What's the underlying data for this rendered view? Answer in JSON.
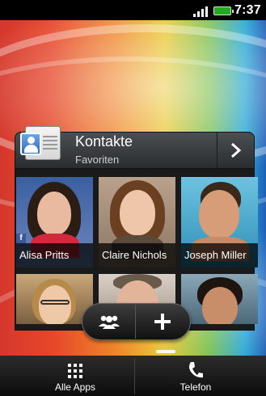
{
  "status_bar": {
    "time": "7:37"
  },
  "widget": {
    "title": "Kontakte",
    "subtitle": "Favoriten",
    "contacts": [
      {
        "name": "Alisa Pritts"
      },
      {
        "name": "Claire Nichols"
      },
      {
        "name": "Joseph Miller"
      },
      {
        "name": ""
      },
      {
        "name": ""
      },
      {
        "name": ""
      }
    ],
    "facebook_badge": "f"
  },
  "dock": {
    "all_apps_label": "Alle Apps",
    "phone_label": "Telefon"
  },
  "icons": {
    "next": "chevron-right-icon",
    "group": "people-icon",
    "add": "plus-icon",
    "all_apps": "grid-icon",
    "phone": "phone-icon"
  }
}
